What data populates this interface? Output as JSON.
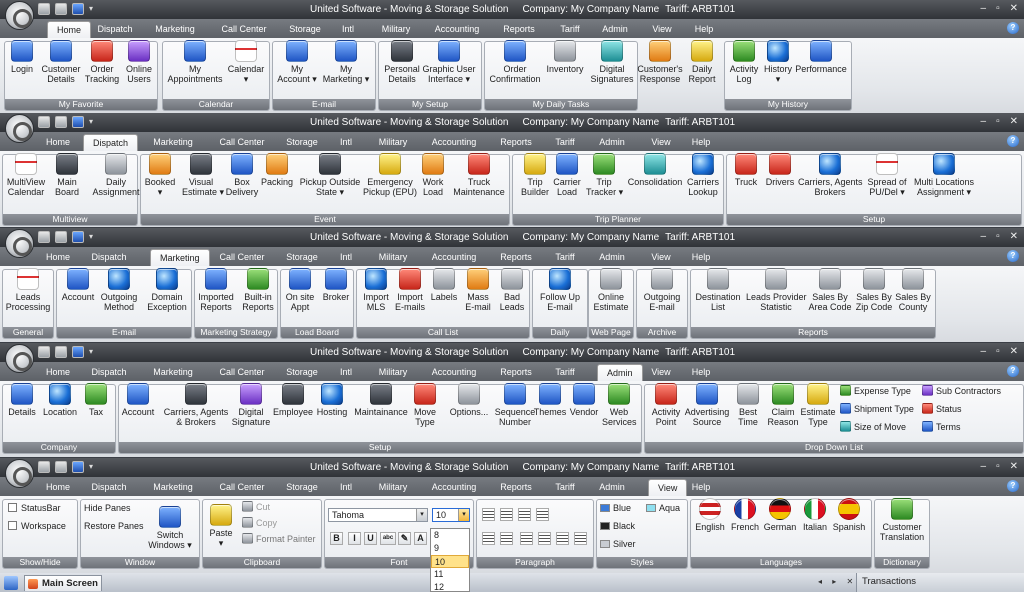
{
  "title_text": "United Software - Moving & Storage Solution",
  "company_text": "Company: My Company Name",
  "tariff_text": "Tariff: ARBT101",
  "tabs": [
    "Home",
    "Dispatch",
    "Marketing",
    "Call Center",
    "Storage",
    "Intl",
    "Military",
    "Accounting",
    "Reports",
    "Tariff",
    "Admin",
    "View",
    "Help"
  ],
  "help_label": "?",
  "window_buttons": [
    "–",
    "▫",
    "✕"
  ],
  "strip1": {
    "groups": [
      "My Favorite",
      "Calendar",
      "E-mail",
      "My Setup",
      "My Daily Tasks",
      "My History"
    ],
    "buttons": [
      [
        "Login"
      ],
      [
        "Customer",
        "Details"
      ],
      [
        "Order",
        "Tracking"
      ],
      [
        "Online",
        "Users"
      ],
      [
        "My",
        "Appointments"
      ],
      [
        "Calendar",
        "▾"
      ],
      [
        "My",
        "Account ▾"
      ],
      [
        "My",
        "Marketing ▾"
      ],
      [
        "Personal",
        "Details"
      ],
      [
        "Graphic User",
        "Interface ▾"
      ],
      [
        "Order",
        "Confirmation"
      ],
      [
        "Inventory"
      ],
      [
        "Digital",
        "Signatures"
      ],
      [
        "Customer's",
        "Response"
      ],
      [
        "Daily",
        "Report"
      ],
      [
        "Activity",
        "Log"
      ],
      [
        "History",
        "▾"
      ],
      [
        "Performance"
      ]
    ]
  },
  "strip2": {
    "groups": [
      "Multiview",
      "Event",
      "Trip Planner",
      "Setup"
    ],
    "buttons": [
      [
        "MultiView",
        "Calendar"
      ],
      [
        "Main",
        "Board"
      ],
      [
        "Daily",
        "Assignment"
      ],
      [
        "Booked",
        "▾"
      ],
      [
        "Visual",
        "Estimate ▾"
      ],
      [
        "Box",
        "Delivery"
      ],
      [
        "Packing"
      ],
      [
        "Pickup Outside",
        "State ▾"
      ],
      [
        "Emergency",
        "Pickup (EPU)"
      ],
      [
        "Work",
        "Load"
      ],
      [
        "Truck",
        "Maintenance"
      ],
      [
        "Trip",
        "Builder"
      ],
      [
        "Carrier",
        "Load"
      ],
      [
        "Trip",
        "Tracker ▾"
      ],
      [
        "Consolidation"
      ],
      [
        "Carriers",
        "Lookup"
      ],
      [
        "Truck"
      ],
      [
        "Drivers"
      ],
      [
        "Carriers, Agents",
        "Brokers"
      ],
      [
        "Spread of",
        "PU/Del ▾"
      ],
      [
        "Multi Locations",
        "Assignment ▾"
      ]
    ]
  },
  "strip3": {
    "groups": [
      "General",
      "E-mail",
      "Marketing Strategy",
      "Load Board",
      "Call List",
      "Daily",
      "Web Page",
      "Archive",
      "Reports"
    ],
    "buttons": [
      [
        "Leads",
        "Processing"
      ],
      [
        "Account"
      ],
      [
        "Outgoing",
        "Method"
      ],
      [
        "Domain",
        "Exception"
      ],
      [
        "Imported",
        "Reports"
      ],
      [
        "Built-in",
        "Reports"
      ],
      [
        "On site",
        "Appt"
      ],
      [
        "Broker"
      ],
      [
        "Import",
        "MLS"
      ],
      [
        "Import",
        "E-mails"
      ],
      [
        "Labels"
      ],
      [
        "Mass",
        "E-mail"
      ],
      [
        "Bad",
        "Leads"
      ],
      [
        "Follow Up",
        "E-mail"
      ],
      [
        "Online",
        "Estimate"
      ],
      [
        "Outgoing",
        "E-mail"
      ],
      [
        "Destination",
        "List"
      ],
      [
        "Leads Provider",
        "Statistic"
      ],
      [
        "Sales By",
        "Area Code"
      ],
      [
        "Sales By",
        "Zip Code"
      ],
      [
        "Sales By",
        "County"
      ]
    ]
  },
  "strip4": {
    "groups": [
      "Company",
      "Setup",
      "Drop Down List"
    ],
    "buttons": [
      [
        "Details"
      ],
      [
        "Location"
      ],
      [
        "Tax"
      ],
      [
        "Account"
      ],
      [
        "Carriers, Agents",
        "& Brokers"
      ],
      [
        "Digital",
        "Signature"
      ],
      [
        "Employee"
      ],
      [
        "Hosting"
      ],
      [
        "Maintainance"
      ],
      [
        "Move",
        "Type"
      ],
      [
        "Options..."
      ],
      [
        "Sequence",
        "Number"
      ],
      [
        "Themes"
      ],
      [
        "Vendor"
      ],
      [
        "Web",
        "Services"
      ],
      [
        "Activity",
        "Point"
      ],
      [
        "Advertising",
        "Source"
      ],
      [
        "Best",
        "Time"
      ],
      [
        "Claim",
        "Reason"
      ],
      [
        "Estimate",
        "Type"
      ]
    ],
    "small": [
      "Expense Type",
      "Shipment Type",
      "Size of Move",
      "Sub Contractors",
      "Status",
      "Terms"
    ]
  },
  "strip5": {
    "groups": [
      "Show/Hide",
      "Window",
      "Clipboard",
      "Font",
      "Paragraph",
      "Styles",
      "Languages",
      "Dictionary"
    ],
    "statusbar": "StatusBar",
    "workspace": "Workspace",
    "hide_panes": "Hide Panes",
    "restore_panes": "Restore Panes",
    "switch_windows": [
      "Switch",
      "Windows ▾"
    ],
    "paste": [
      "Paste",
      "▾"
    ],
    "cut": "Cut",
    "copy": "Copy",
    "format_painter": "Format Painter",
    "font_name": "Tahoma",
    "font_size": "10",
    "size_options": [
      "8",
      "9",
      "10",
      "11",
      "12"
    ],
    "fmt": [
      "B",
      "I",
      "U",
      "abc",
      "✎",
      "A"
    ],
    "styles": [
      "Blue",
      "Aqua",
      "Black",
      "Silver"
    ],
    "languages": [
      "English",
      "French",
      "German",
      "Italian",
      "Spanish"
    ],
    "dictionary": [
      "Customer",
      "Translation"
    ]
  },
  "bottom": {
    "main_tab": "Main Screen",
    "transactions": "Transactions",
    "pane_ctrl": "◂ ▸ ✕"
  }
}
